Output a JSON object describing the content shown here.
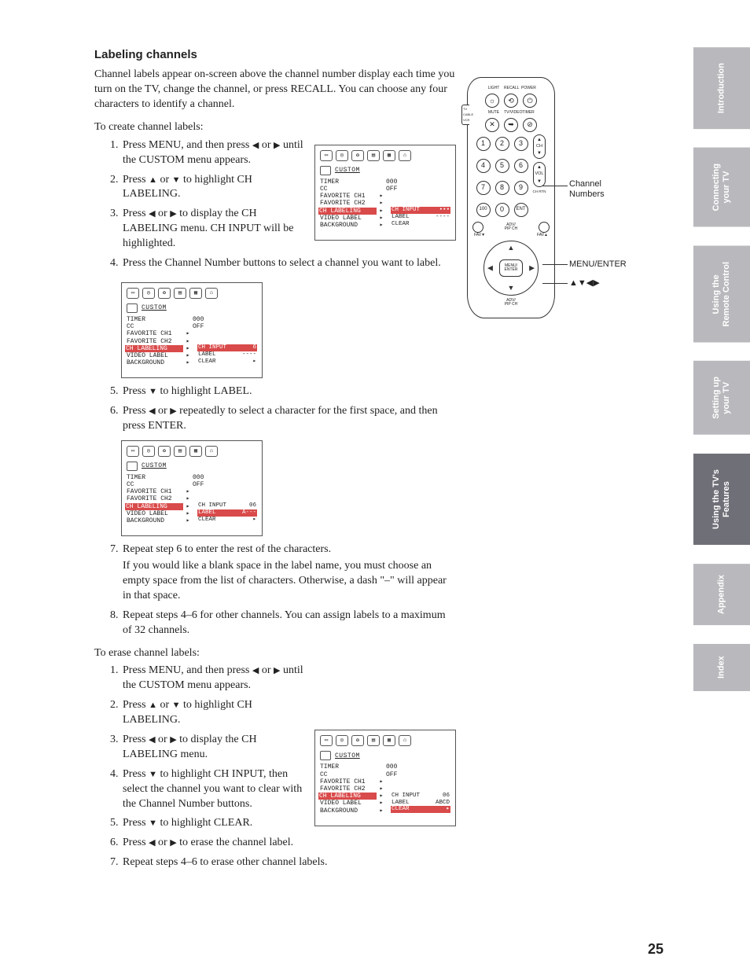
{
  "page_number": "25",
  "title": "Labeling channels",
  "intro": "Channel labels appear on-screen above the channel number display each time you turn on the TV, change the channel, or press RECALL. You can choose any four characters to identify a channel.",
  "create_lead": "To create channel labels:",
  "erase_lead": "To erase channel labels:",
  "create_steps": {
    "s1a": "Press MENU, and then press ",
    "s1b": " or ",
    "s1c": " until the CUSTOM menu appears.",
    "s2a": "Press ",
    "s2b": " or ",
    "s2c": " to highlight CH LABELING.",
    "s3a": "Press ",
    "s3b": " or ",
    "s3c": " to display the CH LABELING menu. CH INPUT will be highlighted.",
    "s4": "Press the Channel Number buttons to select a channel you want to label.",
    "s5a": "Press ",
    "s5b": " to highlight LABEL.",
    "s6a": "Press ",
    "s6b": " or ",
    "s6c": " repeatedly to select a character for the first space, and then press ENTER.",
    "s7": "Repeat step 6 to enter the rest of the characters.",
    "s7note": "If you would like a blank space in the label name, you must choose an empty space from the list of characters. Otherwise, a dash \"–\" will appear in that space.",
    "s8": "Repeat steps 4–6 for other channels. You can assign labels to a maximum of 32 channels."
  },
  "erase_steps": {
    "s1a": "Press MENU, and then press ",
    "s1b": " or ",
    "s1c": " until the CUSTOM menu appears.",
    "s2a": "Press ",
    "s2b": " or ",
    "s2c": " to highlight CH LABELING.",
    "s3a": "Press ",
    "s3b": " or ",
    "s3c": " to display the CH LABELING menu.",
    "s4a": "Press ",
    "s4b": " to highlight CH INPUT, then select the channel you want to clear with the Channel Number buttons.",
    "s5a": "Press ",
    "s5b": " to highlight CLEAR.",
    "s6a": "Press ",
    "s6b": " or ",
    "s6c": " to erase the channel label.",
    "s7": "Repeat steps 4–6 to erase other channel labels."
  },
  "osd": {
    "menu_name": "CUSTOM",
    "items": {
      "timer": "TIMER",
      "cc": "CC",
      "fav1": "FAVORITE CH1",
      "fav2": "FAVORITE CH2",
      "chlbl": "CH LABELING",
      "vlabel": "VIDEO LABEL",
      "bg": "BACKGROUND"
    },
    "vals": {
      "timer": "000",
      "cc": "OFF"
    },
    "sub": {
      "chinput": "CH INPUT",
      "label": "LABEL",
      "clear": "CLEAR",
      "v_blank": "▪▪▪",
      "v_dash": "----",
      "v_6": "6",
      "v_06": "06",
      "v_A": "A---",
      "v_abcd": "ABCD"
    }
  },
  "remote": {
    "top_labels": {
      "light": "LIGHT",
      "recall": "RECALL",
      "power": "POWER"
    },
    "row2_labels": {
      "mute": "MUTE",
      "tvvideo": "TV/VIDEO",
      "timer": "TIMER"
    },
    "switch": {
      "tv": "TV",
      "cable": "CABLE",
      "vcr": "VCR"
    },
    "numbers": [
      "1",
      "2",
      "3",
      "4",
      "5",
      "6",
      "7",
      "8",
      "9",
      "100",
      "0",
      "ENT"
    ],
    "chvol": {
      "ch": "CH",
      "vol": "VOL",
      "chrtn": "CH RTN"
    },
    "fav": {
      "favm": "FAV▼",
      "favp": "FAV▲",
      "adv": "ADV/\nPIP CH"
    },
    "menu": "MENU/\nENTER",
    "callout_chnum": "Channel\nNumbers",
    "callout_menu": "MENU/ENTER",
    "callout_arrows": "▲▼◀▶"
  },
  "tabs": {
    "t1": "Introduction",
    "t2": "Connecting\nyour TV",
    "t3": "Using the\nRemote Control",
    "t4": "Setting up\nyour TV",
    "t5": "Using the TV's\nFeatures",
    "t6": "Appendix",
    "t7": "Index"
  }
}
